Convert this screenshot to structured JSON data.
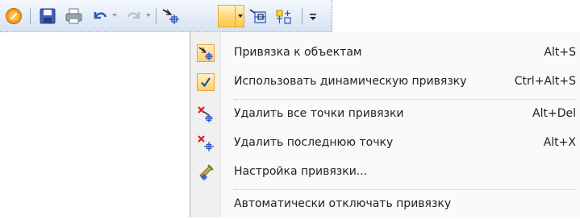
{
  "toolbar": {
    "buttons": [
      {
        "icon": "office-orb-icon"
      },
      {
        "icon": "save-icon"
      },
      {
        "icon": "print-icon"
      },
      {
        "icon": "undo-icon"
      },
      {
        "icon": "redo-icon"
      },
      {
        "icon": "object-snap-icon"
      },
      {
        "icon": "dynamic-snap-icon"
      },
      {
        "icon": "snap-settings-icon"
      },
      {
        "icon": "customize-toolbar-icon"
      }
    ]
  },
  "menu": {
    "items": [
      {
        "icon": "object-snap-icon",
        "label": "Привязка к объектам",
        "shortcut": "Alt+S",
        "checked": false
      },
      {
        "icon": "checkmark-icon",
        "label": "Использовать динамическую привязку",
        "shortcut": "Ctrl+Alt+S",
        "checked": true
      },
      {
        "icon": "delete-all-points-icon",
        "label": "Удалить все точки привязки",
        "shortcut": "Alt+Del",
        "checked": false
      },
      {
        "icon": "delete-last-point-icon",
        "label": "Удалить последнюю точку",
        "shortcut": "Alt+X",
        "checked": false
      },
      {
        "icon": "snap-settings-icon",
        "label": "Настройка привязки...",
        "shortcut": "",
        "checked": false
      },
      {
        "icon": "auto-disable-snap-icon",
        "label": "Автоматически отключать привязку",
        "shortcut": "",
        "checked": false
      }
    ]
  },
  "colors": {
    "accent": "#ffd36b",
    "accent_border": "#e8a33d",
    "check": "#1f4f9a",
    "delete_red": "#d32020"
  }
}
